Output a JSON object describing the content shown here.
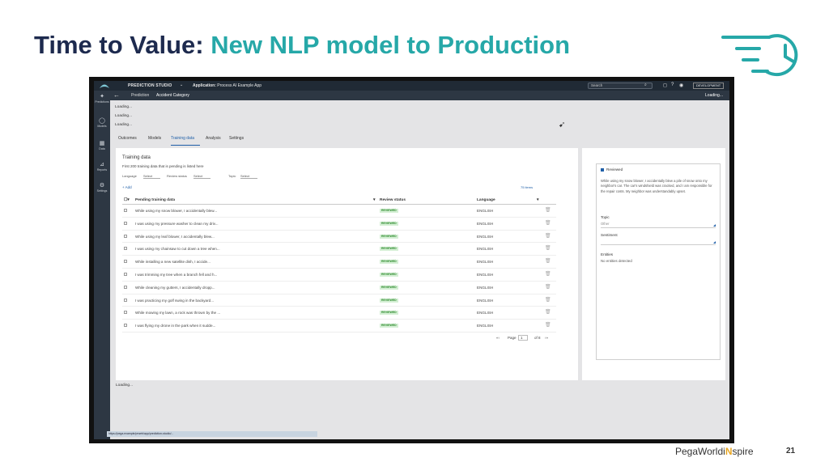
{
  "slide": {
    "title_part1": "Time to Value:",
    "title_part2": "New NLP model to Production",
    "footer_brand_a": "PegaWorld",
    "footer_brand_b": "i",
    "footer_brand_c": "N",
    "footer_brand_d": "spire",
    "page_number": "21",
    "accent_color": "#26a8a8",
    "title_color": "#1d2a4e"
  },
  "app": {
    "studio_label": "PREDICTION STUDIO",
    "application_label": "Application:",
    "application_value": "Process AI Example App",
    "search_placeholder": "Search",
    "environment_badge": "DEVELOPMENT",
    "loading_top": "Loading...",
    "breadcrumb": [
      "Prediction",
      "Accident Category"
    ],
    "left_nav": [
      {
        "label": "Predictions",
        "icon": "sparkle-icon"
      },
      {
        "label": "Models",
        "icon": "circle-icon"
      },
      {
        "label": "Data",
        "icon": "grid-icon"
      },
      {
        "label": "Reports",
        "icon": "chart-icon"
      },
      {
        "label": "Settings",
        "icon": "gear-icon"
      }
    ],
    "loading_lines": [
      "Loading...",
      "Loading...",
      "Loading..."
    ],
    "tabs": [
      "Outcomes",
      "Models",
      "Training data",
      "Analysis",
      "Settings"
    ],
    "active_tab": "Training data",
    "loading_bottom": "Loading...",
    "status_url": "https://pega.example/prweb/app/prediction-studio/..."
  },
  "training": {
    "title": "Training data",
    "subtitle": "First 200 training data that is pending is listed here",
    "filters": {
      "language_label": "Language",
      "language_value": "Select",
      "review_label": "Review status",
      "review_value": "Select",
      "topic_label": "Topic",
      "topic_value": "Select"
    },
    "add_label": "+ Add",
    "items_label": "75 items",
    "columns": [
      "Pending training data",
      "Review status",
      "Language"
    ],
    "rows": [
      {
        "text": "While using my snow blower, I accidentally blew...",
        "status": "REVIEWED",
        "language": "ENGLISH"
      },
      {
        "text": "I was using my pressure washer to clean my driv...",
        "status": "REVIEWED",
        "language": "ENGLISH"
      },
      {
        "text": "While using my leaf blower, I accidentally blew...",
        "status": "REVIEWED",
        "language": "ENGLISH"
      },
      {
        "text": "I was using my chainsaw to cut down a tree when...",
        "status": "REVIEWED",
        "language": "ENGLISH"
      },
      {
        "text": "While installing a new satellite dish, I accide...",
        "status": "REVIEWED",
        "language": "ENGLISH"
      },
      {
        "text": "I was trimming my tree when a branch fell and h...",
        "status": "REVIEWED",
        "language": "ENGLISH"
      },
      {
        "text": "While cleaning my gutters, I accidentally dropp...",
        "status": "REVIEWED",
        "language": "ENGLISH"
      },
      {
        "text": "I was practicing my golf swing in the backyard...",
        "status": "REVIEWED",
        "language": "ENGLISH"
      },
      {
        "text": "While mowing my lawn, a rock was thrown by the ...",
        "status": "REVIEWED",
        "language": "ENGLISH"
      },
      {
        "text": "I was flying my drone in the park when it sudde...",
        "status": "REVIEWED",
        "language": "ENGLISH"
      }
    ],
    "pager": {
      "prev": "«‹",
      "page_label": "Page",
      "page_value": "1",
      "of_label": "of 8",
      "next": "›»"
    }
  },
  "detail": {
    "reviewed_label": "Reviewed",
    "description": "While using my snow blower, I accidentally blew a pile of snow onto my neighbor's car. The car's windshield was cracked, and I am responsible for the repair costs. My neighbor was understandably upset.",
    "topic_label": "Topic",
    "topic_value": "Other",
    "sentiment_label": "Sentiment",
    "sentiment_value": "",
    "entities_label": "Entities",
    "entities_value": "No entities detected"
  }
}
